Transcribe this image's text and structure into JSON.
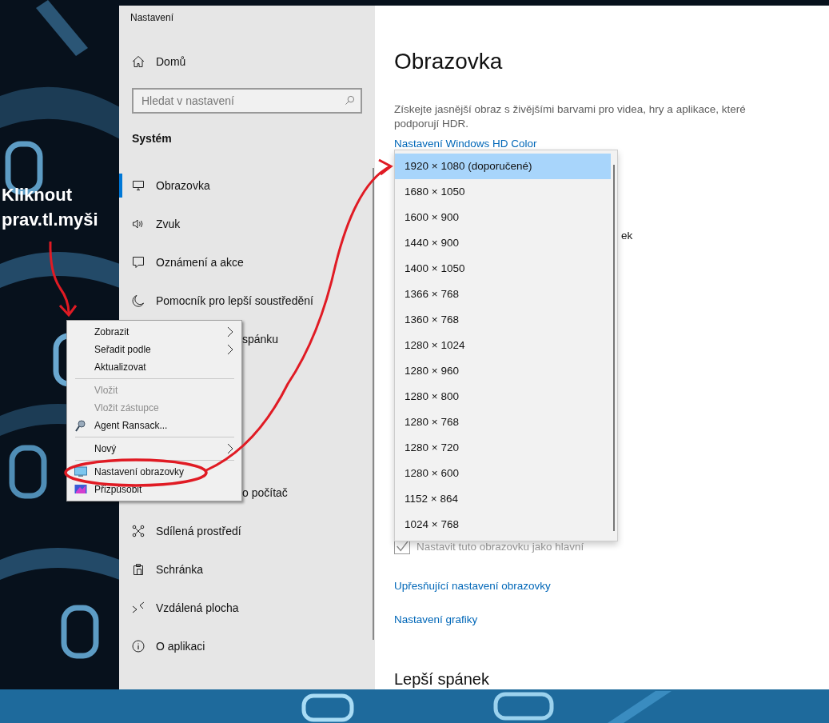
{
  "window": {
    "title": "Nastavení"
  },
  "sidebar": {
    "home": "Domů",
    "search": {
      "placeholder": "Hledat v nastavení"
    },
    "section": "Systém",
    "items": [
      {
        "kind": "monitor",
        "label": "Obrazovka",
        "selected": true
      },
      {
        "kind": "speaker",
        "label": "Zvuk",
        "selected": false
      },
      {
        "kind": "message",
        "label": "Oznámení a akce",
        "selected": false
      },
      {
        "kind": "moon",
        "label": "Pomocník pro lepší soustředění",
        "selected": false
      },
      {
        "kind": "covered",
        "label": "spánku"
      }
    ],
    "items_lower": [
      {
        "kind": "covered",
        "label": "o počítač"
      },
      {
        "kind": "share",
        "label": "Sdílená prostředí",
        "selected": false
      },
      {
        "kind": "clipboard",
        "label": "Schránka",
        "selected": false
      },
      {
        "kind": "remote",
        "label": "Vzdálená plocha",
        "selected": false
      },
      {
        "kind": "info",
        "label": "O aplikaci",
        "selected": false
      }
    ]
  },
  "content": {
    "title": "Obrazovka",
    "hd_description": "Získejte jasnější obraz s živějšími barvami pro videa, hry a aplikace, které podporují HDR.",
    "hd_link": "Nastavení Windows HD Color",
    "covered_fragment": "ek",
    "main_display": {
      "label": "Nastavit tuto obrazovku jako hlavní",
      "checked": true,
      "disabled": true
    },
    "links": [
      "Upřesňující nastavení obrazovky",
      "Nastavení grafiky"
    ],
    "next_heading": "Lepší spánek"
  },
  "resolution_dropdown": {
    "options": [
      {
        "label": "1920 × 1080 (doporučené)",
        "selected": true
      },
      {
        "label": "1680 × 1050",
        "selected": false
      },
      {
        "label": "1600 × 900",
        "selected": false
      },
      {
        "label": "1440 × 900",
        "selected": false
      },
      {
        "label": "1400 × 1050",
        "selected": false
      },
      {
        "label": "1366 × 768",
        "selected": false
      },
      {
        "label": "1360 × 768",
        "selected": false
      },
      {
        "label": "1280 × 1024",
        "selected": false
      },
      {
        "label": "1280 × 960",
        "selected": false
      },
      {
        "label": "1280 × 800",
        "selected": false
      },
      {
        "label": "1280 × 768",
        "selected": false
      },
      {
        "label": "1280 × 720",
        "selected": false
      },
      {
        "label": "1280 × 600",
        "selected": false
      },
      {
        "label": "1152 × 864",
        "selected": false
      },
      {
        "label": "1024 × 768",
        "selected": false
      }
    ]
  },
  "context_menu": {
    "items": [
      {
        "kind": "item",
        "label": "Zobrazit",
        "submenu": true,
        "disabled": false
      },
      {
        "kind": "item",
        "label": "Seřadit podle",
        "submenu": true,
        "disabled": false
      },
      {
        "kind": "item",
        "label": "Aktualizovat",
        "submenu": false,
        "disabled": false
      },
      {
        "kind": "separator"
      },
      {
        "kind": "item",
        "label": "Vložit",
        "submenu": false,
        "disabled": true
      },
      {
        "kind": "item",
        "label": "Vložit zástupce",
        "submenu": false,
        "disabled": true
      },
      {
        "kind": "agent",
        "label": "Agent Ransack...",
        "submenu": false,
        "disabled": false
      },
      {
        "kind": "separator"
      },
      {
        "kind": "item",
        "label": "Nový",
        "submenu": true,
        "disabled": false
      },
      {
        "kind": "separator"
      },
      {
        "kind": "display",
        "label": "Nastavení obrazovky",
        "submenu": false,
        "disabled": false
      },
      {
        "kind": "personalize",
        "label": "Přizpůsobit",
        "submenu": false,
        "disabled": false
      }
    ]
  },
  "annotation": {
    "lines": [
      "Kliknout",
      "prav.tl.myši"
    ]
  }
}
